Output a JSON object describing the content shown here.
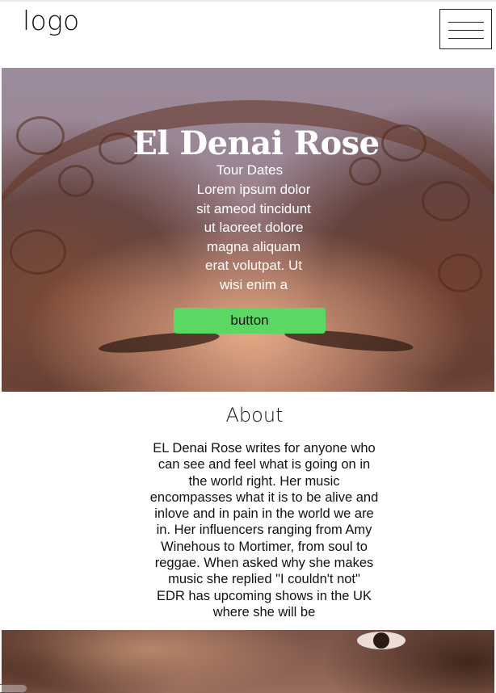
{
  "header": {
    "logo": "logo",
    "menu_icon": "hamburger-menu-icon"
  },
  "hero": {
    "title": "El Denai Rose",
    "subtitle": "Tour Dates",
    "text_lines": [
      "Lorem ipsum dolor",
      "sit amеod tincidunt",
      "ut laoreet dolore",
      "magna aliquam",
      "erat volutpat. Ut",
      "wisi enim a"
    ],
    "button_label": "button",
    "button_color": "#5ad863"
  },
  "about": {
    "title": "About",
    "text_lines": [
      "EL Denai Rose writes for anyone who",
      "can see and feel what is going on in",
      "the world right. Her music",
      "encompasses what it is to be alive and",
      "inlove and in pain in the world we are",
      "in. Her influencers ranging from Amy",
      "Winehous to Mortimer, from soul to",
      "reggae. When asked why she makes",
      "music she replied \"I couldn't not\"",
      "EDR has upcoming shows in the UK",
      "where she will be"
    ]
  }
}
